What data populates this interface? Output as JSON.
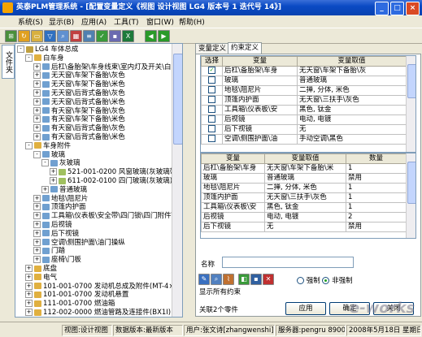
{
  "window": {
    "title": "英泰PLM管理系统 - [配置变量定义《视图 设计视图 LG4 版本号 1 迭代号 14》]",
    "controls": [
      "_",
      "□",
      "×"
    ]
  },
  "menu": [
    "系统(S)",
    "显示(B)",
    "应用(A)",
    "工具(T)",
    "窗口(W)",
    "帮助(H)"
  ],
  "toolbar_icons": [
    "tree-icon",
    "refresh-icon",
    "open-icon",
    "filter-icon",
    "search-icon",
    "grid-icon",
    "list-icon",
    "check-icon",
    "save-icon",
    "excel-icon",
    "back-arrow-icon",
    "forward-arrow-icon"
  ],
  "sidebar": {
    "tab_label": "文件夹"
  },
  "tree": [
    {
      "label": "LG4 车体总成",
      "level": 0,
      "exp": "-"
    },
    {
      "label": "白车身",
      "level": 1,
      "exp": "-"
    },
    {
      "label": "后杠\\备胎架\\车身线束\\室内灯及开关\\白车",
      "level": 2,
      "exp": "+"
    },
    {
      "label": "无天窗\\车架下备胎\\灰色",
      "level": 2,
      "exp": "+"
    },
    {
      "label": "无天窗\\车架下备胎\\米色",
      "level": 2,
      "exp": "+"
    },
    {
      "label": "无天窗\\后背式备胎\\灰色",
      "level": 2,
      "exp": "+"
    },
    {
      "label": "无天窗\\后背式备胎\\米色",
      "level": 2,
      "exp": "+"
    },
    {
      "label": "有天窗\\车架下备胎\\灰色",
      "level": 2,
      "exp": "+"
    },
    {
      "label": "有天窗\\车架下备胎\\米色",
      "level": 2,
      "exp": "+"
    },
    {
      "label": "有天窗\\后背式备胎\\灰色",
      "level": 2,
      "exp": "+"
    },
    {
      "label": "有天窗\\后背式备胎\\米色",
      "level": 2,
      "exp": "+"
    },
    {
      "label": "车身附件",
      "level": 1,
      "exp": "-"
    },
    {
      "label": "玻璃",
      "level": 2,
      "exp": "-"
    },
    {
      "label": "灰玻璃",
      "level": 3,
      "exp": "-"
    },
    {
      "label": "521-001-0200  风窗玻璃(灰玻璃带",
      "level": 4,
      "exp": "+"
    },
    {
      "label": "611-002-0100  四门玻璃(灰玻璃)",
      "level": 4,
      "exp": "+"
    },
    {
      "label": "普通玻璃",
      "level": 3,
      "exp": "+"
    },
    {
      "label": "地毯\\阻尼片",
      "level": 2,
      "exp": "+"
    },
    {
      "label": "顶篷内护面",
      "level": 2,
      "exp": "+"
    },
    {
      "label": "工具箱\\仪表板\\安全带\\四门锁\\四门附件\\",
      "level": 2,
      "exp": "+"
    },
    {
      "label": "后视镜",
      "level": 2,
      "exp": "+"
    },
    {
      "label": "后下视镜",
      "level": 2,
      "exp": "+"
    },
    {
      "label": "空调\\侧围护面\\油门操纵",
      "level": 2,
      "exp": "+"
    },
    {
      "label": "门踏",
      "level": 2,
      "exp": "+"
    },
    {
      "label": "座椅\\门板",
      "level": 2,
      "exp": "+"
    },
    {
      "label": "底盘",
      "level": 1,
      "exp": "+"
    },
    {
      "label": "电气",
      "level": 1,
      "exp": "+"
    },
    {
      "label": "101-001-0700  发动机总成及附件(MT-4×4)",
      "level": 1,
      "exp": "+"
    },
    {
      "label": "101-001-0700  发动机悬置",
      "level": 1,
      "exp": "+"
    },
    {
      "label": "111-001-0700  燃油箱",
      "level": 1,
      "exp": "+"
    },
    {
      "label": "112-002-0000  燃油管路及连接件(BX1I)",
      "level": 1,
      "exp": "+"
    }
  ],
  "tabs": [
    "变量定义",
    "约束定义"
  ],
  "constraint_table": {
    "headers": [
      "选择",
      "变量",
      "变量取值"
    ],
    "rows": [
      {
        "checked": true,
        "var": "后杠\\备胎架\\车身",
        "val": "无天窗\\车架下备胎\\灰"
      },
      {
        "checked": false,
        "var": "玻璃",
        "val": "普通玻璃"
      },
      {
        "checked": false,
        "var": "地毯\\阻尼片",
        "val": "二掸, 分体, 米色"
      },
      {
        "checked": false,
        "var": "顶篷内护面",
        "val": "无天窗\\三扶手\\灰色"
      },
      {
        "checked": false,
        "var": "工具箱\\仪表板\\安",
        "val": "黑色, 钛金"
      },
      {
        "checked": false,
        "var": "后视镜",
        "val": "电动, 电镀"
      },
      {
        "checked": false,
        "var": "后下视镜",
        "val": "无"
      },
      {
        "checked": false,
        "var": "空调\\侧围护面\\油",
        "val": "手动空调\\黑色"
      }
    ]
  },
  "result_table": {
    "headers": [
      "变量",
      "变量取值",
      "数量"
    ],
    "rows": [
      {
        "var": "后杠\\备胎架\\车身",
        "val": "无天窗\\车架下备胎\\米",
        "qty": "1"
      },
      {
        "var": "玻璃",
        "val": "普通玻璃",
        "qty": "禁用"
      },
      {
        "var": "地毯\\阻尼片",
        "val": "二掸, 分体, 米色",
        "qty": "1"
      },
      {
        "var": "顶篷内护面",
        "val": "无天窗\\三扶手\\灰色",
        "qty": "1"
      },
      {
        "var": "工具箱\\仪表板\\安",
        "val": "黑色, 钛金",
        "qty": "1"
      },
      {
        "var": "后视镜",
        "val": "电动, 电镀",
        "qty": "2"
      },
      {
        "var": "后下视镜",
        "val": "无",
        "qty": "禁用"
      }
    ]
  },
  "form": {
    "name_label": "名称",
    "name_value": "",
    "radio_options": [
      "强制",
      "非强制"
    ],
    "radio_selected": "非强制",
    "show_all_label": "显示所有约束",
    "related_count": "关联2个零件",
    "apply_btn": "应用",
    "ok_btn": "确定",
    "cancel_btn": "关闭"
  },
  "status": {
    "view": "视图:设计视图",
    "db": "数据版本:最新版本",
    "user": "用户:张文诗[zhangwenshi]",
    "server": "服务器:pengru 8900",
    "date": "2008年5月18日 星期日"
  },
  "watermark": "e-works"
}
